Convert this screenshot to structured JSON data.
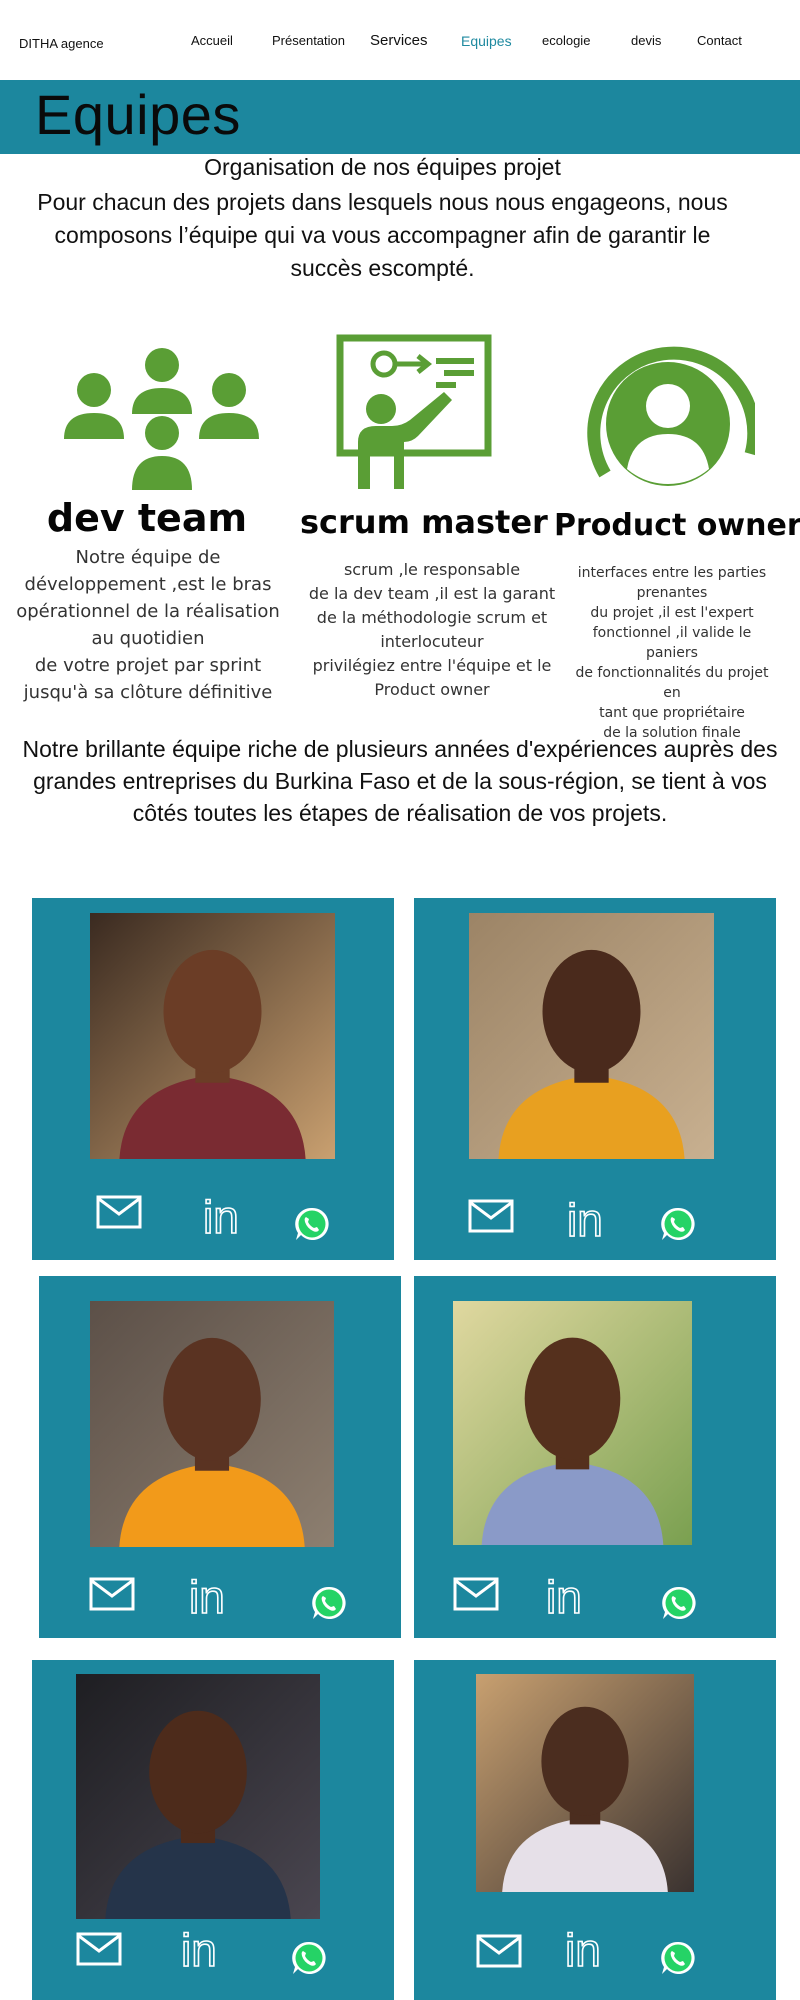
{
  "nav": {
    "brand": "DITHA agence",
    "items": [
      "Accueil",
      "Présentation",
      "Services",
      "Equipes",
      "ecologie",
      "devis",
      "Contact"
    ],
    "active": "Equipes"
  },
  "page": {
    "title": "Equipes",
    "subtitle": "Organisation de nos équipes projet",
    "intro": "Pour chacun des projets dans lesquels nous nous engageons, nous composons l’équipe qui va vous accompagner afin de garantir le succès escompté."
  },
  "roles": [
    {
      "title": "dev team",
      "icon": "team-icon",
      "lines": [
        "Notre équipe de",
        "développement ,est le bras",
        "opérationnel de la réalisation",
        "au quotidien",
        "de votre projet par sprint",
        "jusqu'à sa clôture définitive"
      ]
    },
    {
      "title": "scrum master",
      "icon": "presenter-icon",
      "lines": [
        "scrum ,le responsable",
        "de la dev team ,il est la garant",
        "de la méthodologie scrum et",
        "interlocuteur",
        "privilégiez entre l'équipe et le",
        "Product owner"
      ]
    },
    {
      "title": "Product owner",
      "icon": "user-circle-icon",
      "lines": [
        "interfaces entre les parties",
        "prenantes",
        "du projet ,il est l'expert",
        "fonctionnel ,il valide le paniers",
        "de fonctionnalités du projet en",
        "tant que propriétaire",
        "de la solution finale"
      ]
    }
  ],
  "tagline": "Notre brillante équipe riche de plusieurs années d'expériences auprès des grandes entreprises du Burkina Faso et de la sous-région, se tient à vos côtés toutes les étapes de réalisation de vos projets.",
  "team_cards": {
    "count": 6,
    "icons": [
      "mail-icon",
      "linkedin-icon",
      "whatsapp-icon"
    ],
    "linkedin_text": "in"
  },
  "colors": {
    "accent": "#1c879e",
    "icon_green": "#5a9e35",
    "whatsapp": "#25d366",
    "active_link": "#1f8aa0"
  }
}
